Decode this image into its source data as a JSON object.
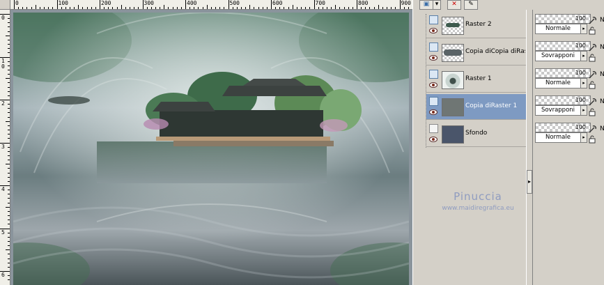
{
  "ruler": {
    "top_labels": [
      "0",
      "100",
      "200",
      "300",
      "400",
      "500",
      "600",
      "700",
      "800",
      "900"
    ],
    "left_labels": [
      "0",
      "1\n0",
      "2",
      "3",
      "4",
      "5",
      "6"
    ]
  },
  "layers": [
    {
      "name": "Raster 2",
      "selected": false,
      "kind": "raster"
    },
    {
      "name": "Copia diCopia diRast",
      "selected": false,
      "kind": "raster"
    },
    {
      "name": "Raster 1",
      "selected": false,
      "kind": "raster"
    },
    {
      "name": "Copia diRaster 1",
      "selected": true,
      "kind": "raster"
    },
    {
      "name": "Sfondo",
      "selected": false,
      "kind": "background"
    }
  ],
  "properties": [
    {
      "opacity": "100",
      "blend": "Normale",
      "n": "N"
    },
    {
      "opacity": "100",
      "blend": "Sovrapponi",
      "n": "N"
    },
    {
      "opacity": "100",
      "blend": "Normale",
      "n": "N"
    },
    {
      "opacity": "100",
      "blend": "Sovrapponi",
      "n": "N"
    },
    {
      "opacity": "100",
      "blend": "Normale",
      "n": "N"
    }
  ],
  "watermark": {
    "title": "Pinuccia",
    "url": "www.maidiregrafica.eu"
  },
  "colors": {
    "selected_row": "#7e9ac2",
    "panel_bg": "#d4d0c8",
    "watermark": "#8f9cc0"
  }
}
